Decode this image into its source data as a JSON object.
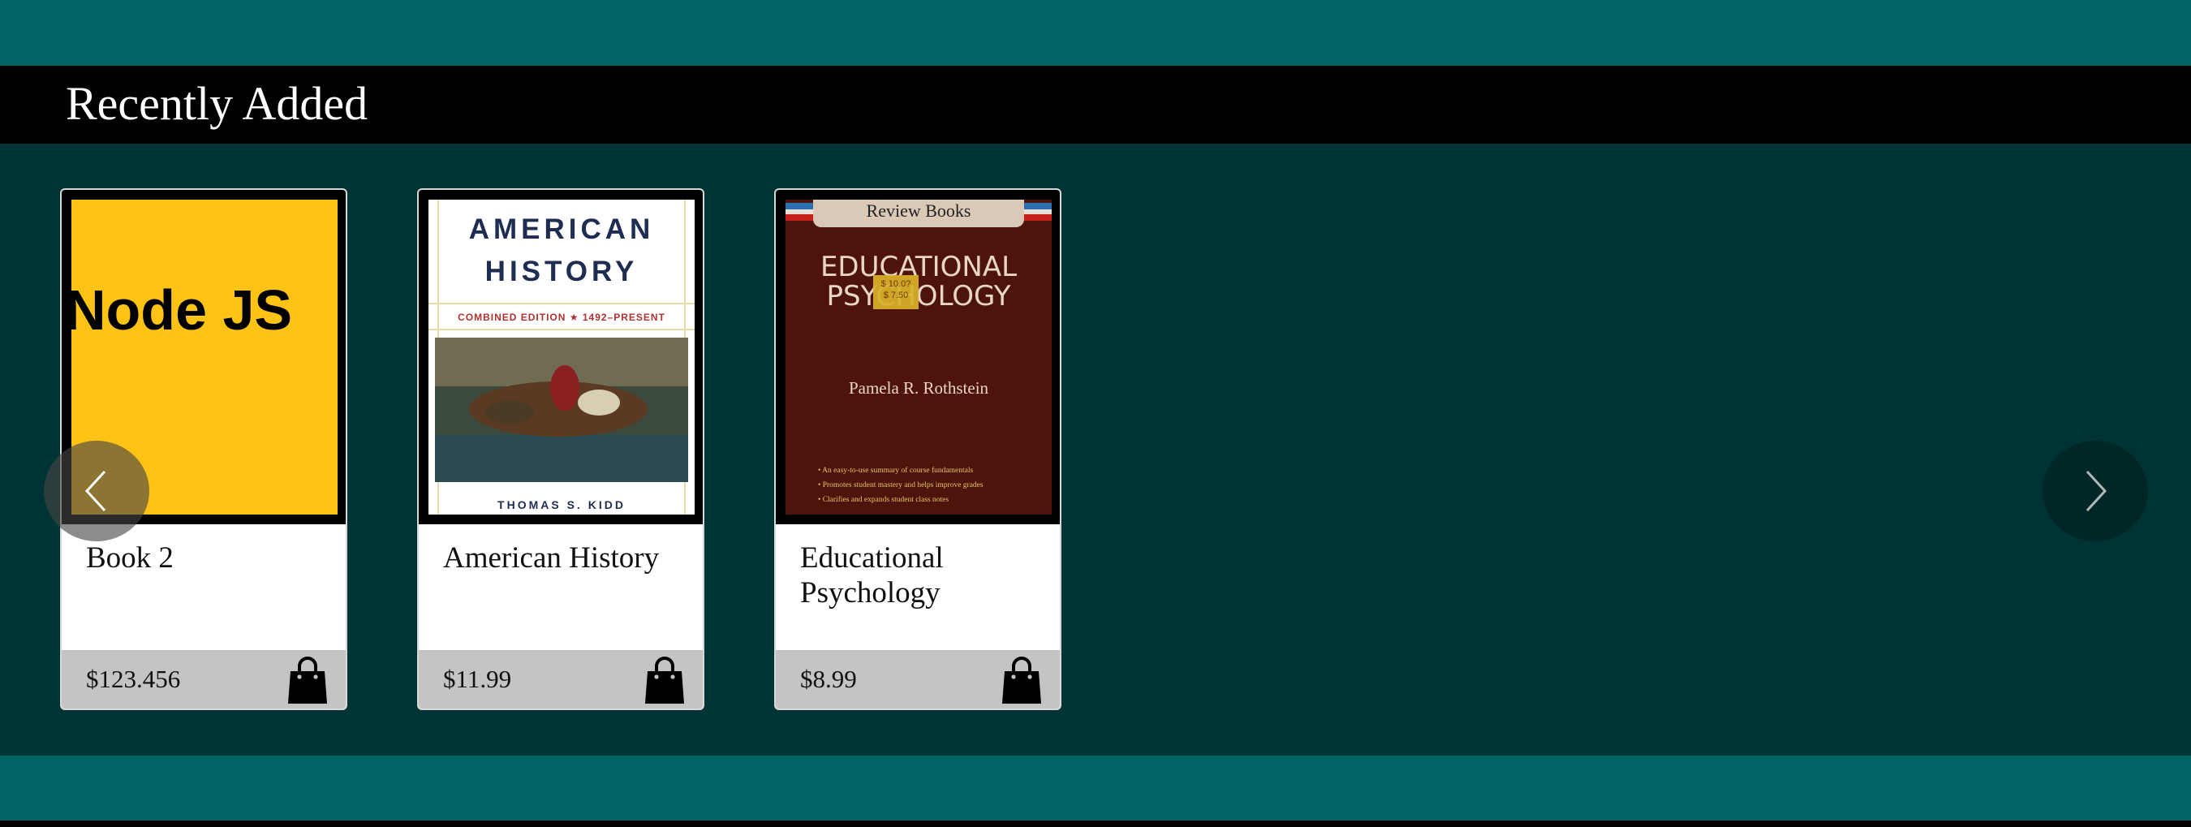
{
  "section": {
    "title": "Recently Added"
  },
  "carousel": {
    "prev_icon": "chevron-left-icon",
    "next_icon": "chevron-right-icon"
  },
  "books": [
    {
      "title": "Book 2",
      "price": "$123.456",
      "cover": {
        "text": "Node JS",
        "bg": "#fec314"
      }
    },
    {
      "title": "American History",
      "price": "$11.99",
      "cover": {
        "line1": "AMERICAN",
        "line2": "HISTORY",
        "edition": "COMBINED EDITION ★ 1492–PRESENT",
        "author": "THOMAS S. KIDD"
      }
    },
    {
      "title": "Educational Psychology",
      "price": "$8.99",
      "cover": {
        "series": "Review Books",
        "line1": "EDUCATIONAL",
        "line2": "PSYCHOLOGY",
        "author": "Pamela R. Rothstein",
        "sticker_line1": "$ 10.0?",
        "sticker_line2": "$ 7.50",
        "bullets": [
          "• An easy-to-use summary of course fundamentals",
          "• Promotes student mastery and helps improve grades",
          "• Clarifies and expands student class notes"
        ]
      }
    }
  ],
  "cart_icon": "shopping-bag-icon",
  "colors": {
    "teal_band": "#016464",
    "carousel_bg": "#003334",
    "header_bg": "#000000",
    "footer_bg": "#c4c4c4"
  }
}
